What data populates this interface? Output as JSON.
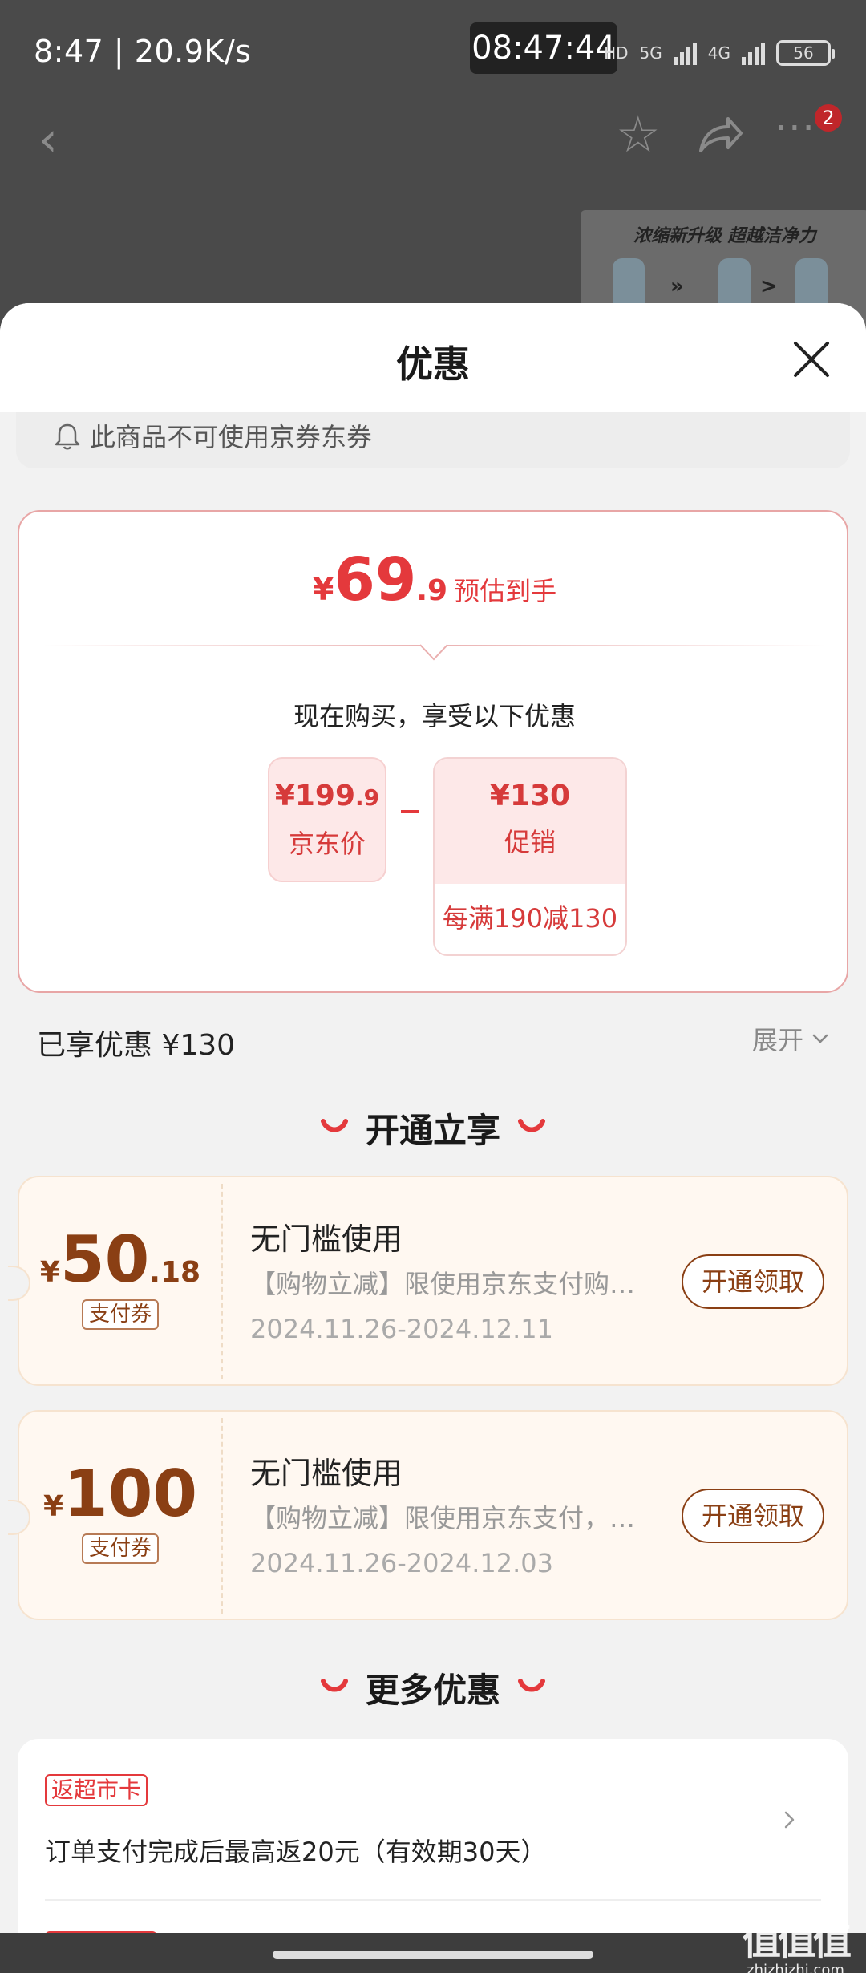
{
  "status_bar": {
    "left_text": "8:47 | 20.9K/s",
    "clock_pill": "08:47:44",
    "hd_label": "HD",
    "net1": "5G",
    "net2": "4G",
    "battery": "56"
  },
  "nav": {
    "badge_count": "2"
  },
  "banner": {
    "text": "浓缩新升级 超越洁净力"
  },
  "sheet": {
    "title": "优惠",
    "notice": "此商品不可使用京券东券"
  },
  "price_card": {
    "currency": "¥",
    "estimate_int": "69",
    "estimate_dec": ".9",
    "estimate_label": "预估到手",
    "subtitle": "现在购买，享受以下优惠",
    "jd_price_int": "¥199",
    "jd_price_dec": ".9",
    "jd_price_label": "京东价",
    "promo_amount": "¥130",
    "promo_label": "促销",
    "promo_rule": "每满190减130"
  },
  "summary": {
    "enjoyed": "已享优惠 ¥130",
    "expand": "展开"
  },
  "section_open": {
    "title": "开通立享"
  },
  "coupons": [
    {
      "currency": "¥",
      "amount_int": "50",
      "amount_dec": ".18",
      "tag": "支付券",
      "title": "无门槛使用",
      "desc": "【购物立减】限使用京东支付购…",
      "date": "2024.11.26-2024.12.11",
      "button": "开通领取"
    },
    {
      "currency": "¥",
      "amount_int": "100",
      "amount_dec": "",
      "tag": "支付券",
      "title": "无门槛使用",
      "desc": "【购物立减】限使用京东支付，…",
      "date": "2024.11.26-2024.12.03",
      "button": "开通领取"
    }
  ],
  "section_more": {
    "title": "更多优惠"
  },
  "more": {
    "tag": "返超市卡",
    "text": "订单支付完成后最高返20元（有效期30天）"
  },
  "watermark": {
    "logo": "值值值",
    "site": "zhizhizhi.com"
  },
  "colors": {
    "accent_red": "#e4393c",
    "coupon_brown": "#8a3f14",
    "coupon_bg": "#fff8f1"
  }
}
